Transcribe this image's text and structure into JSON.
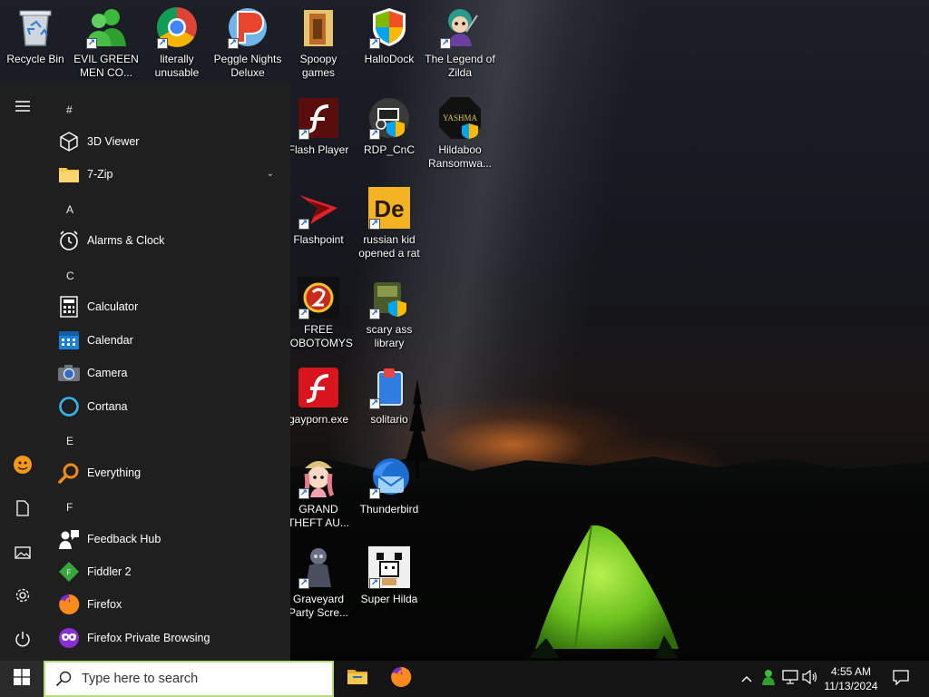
{
  "desktop": {
    "icons": [
      {
        "label": "Recycle Bin"
      },
      {
        "label": "EVIL GREEN MEN CO..."
      },
      {
        "label": "literally unusable"
      },
      {
        "label": "Peggle Nights Deluxe"
      },
      {
        "label": "Spoopy games"
      },
      {
        "label": "HalloDock"
      },
      {
        "label": "The Legend of Zilda"
      },
      {
        "label": "Flash Player"
      },
      {
        "label": "RDP_CnC"
      },
      {
        "label": "Hildaboo Ransomwa..."
      },
      {
        "label": "Flashpoint"
      },
      {
        "label": "russian kid opened a rat"
      },
      {
        "label": "FREE LOBOTOMYS"
      },
      {
        "label": "scary ass library"
      },
      {
        "label": "gayporn.exe"
      },
      {
        "label": "solitario"
      },
      {
        "label": "GRAND THEFT AU..."
      },
      {
        "label": "Thunderbird"
      },
      {
        "label": "Graveyard Party Scre..."
      },
      {
        "label": "Super Hilda"
      }
    ],
    "icon_text": {
      "yashma": "YASHMA",
      "de": "De"
    }
  },
  "start_menu": {
    "groups": [
      {
        "letter": "#"
      },
      {
        "letter": "A"
      },
      {
        "letter": "C"
      },
      {
        "letter": "E"
      },
      {
        "letter": "F"
      }
    ],
    "apps": [
      {
        "name": "3D Viewer"
      },
      {
        "name": "7-Zip"
      },
      {
        "name": "Alarms & Clock"
      },
      {
        "name": "Calculator"
      },
      {
        "name": "Calendar"
      },
      {
        "name": "Camera"
      },
      {
        "name": "Cortana"
      },
      {
        "name": "Everything"
      },
      {
        "name": "Feedback Hub"
      },
      {
        "name": "Fiddler 2"
      },
      {
        "name": "Firefox"
      },
      {
        "name": "Firefox Private Browsing"
      }
    ]
  },
  "taskbar": {
    "search_placeholder": "Type here to search",
    "time": "4:55 AM",
    "date": "11/13/2024"
  },
  "colors": {
    "start_menu_bg": "#1f1f1f",
    "taskbar_bg": "#141414",
    "search_border": "#b7dd7a",
    "tent_green": "#7fd02a"
  }
}
